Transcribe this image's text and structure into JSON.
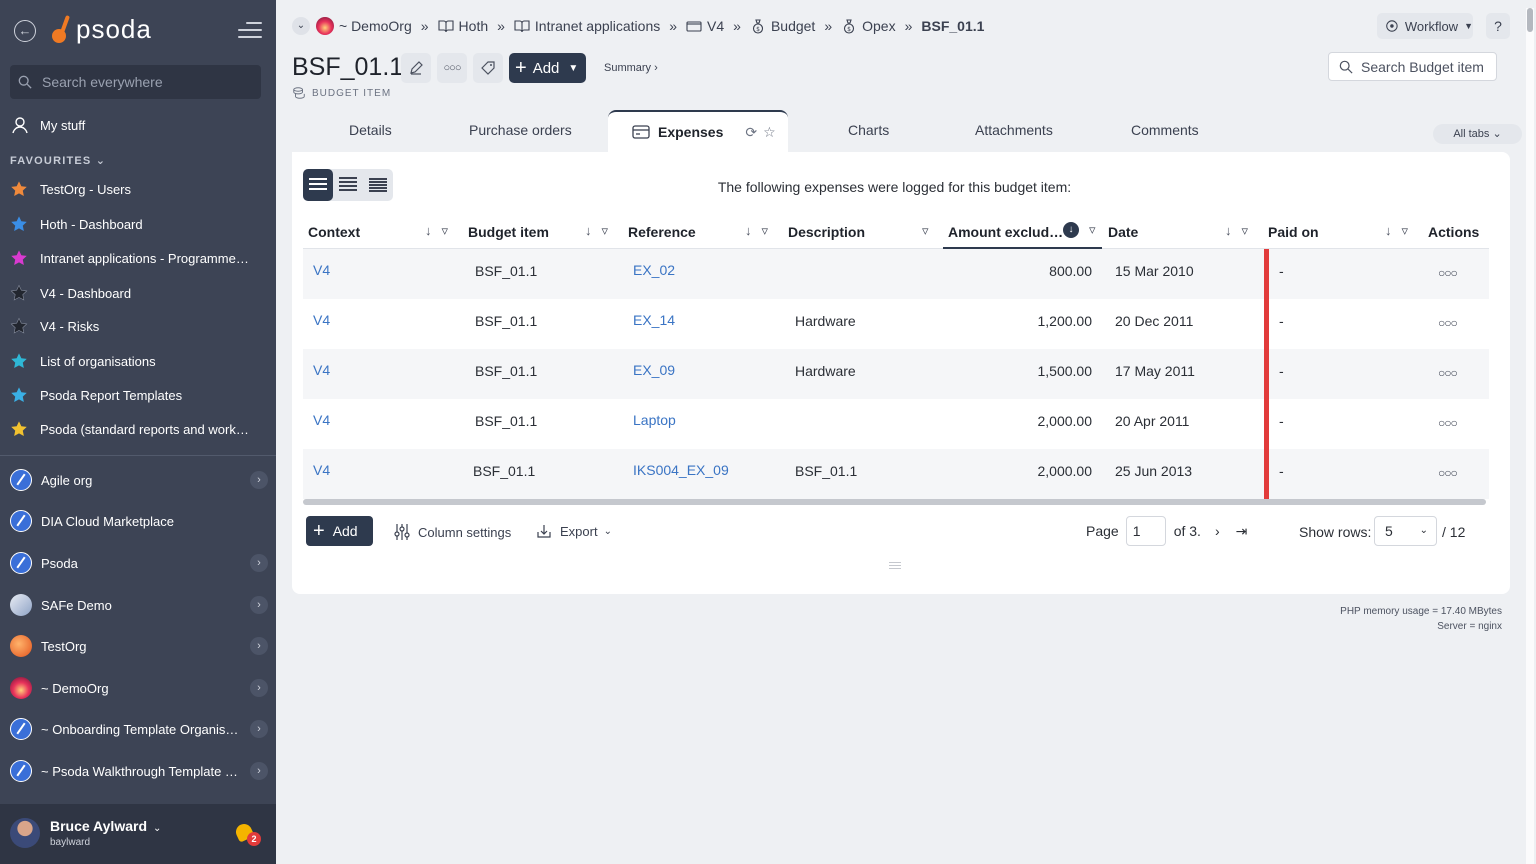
{
  "sidebar": {
    "logo_text": "psoda",
    "search_placeholder": "Search everywhere",
    "my_stuff": "My stuff",
    "favourites_heading": "FAVOURITES",
    "favourites": [
      {
        "label": "TestOrg - Users",
        "star_color": "#f08a3c"
      },
      {
        "label": "Hoth - Dashboard",
        "star_color": "#3a8ee6"
      },
      {
        "label": "Intranet applications - Programme…",
        "star_color": "#d93ad0"
      },
      {
        "label": "V4 - Dashboard",
        "star_color": "#2a2e38"
      },
      {
        "label": "V4 - Risks",
        "star_color": "#2a2e38"
      },
      {
        "label": "List of organisations",
        "star_color": "#2fb8d6"
      },
      {
        "label": "Psoda Report Templates",
        "star_color": "#3ab0e6"
      },
      {
        "label": "Psoda (standard reports and work…",
        "star_color": "#f2c230"
      }
    ],
    "orgs": [
      {
        "label": "Agile org",
        "icon": "compass-icon",
        "chevron": true
      },
      {
        "label": "DIA Cloud Marketplace",
        "icon": "compass-icon",
        "chevron": false
      },
      {
        "label": "Psoda",
        "icon": "compass-icon",
        "chevron": true
      },
      {
        "label": "SAFe Demo",
        "icon": "safe-icon",
        "chevron": true
      },
      {
        "label": "TestOrg",
        "icon": "testorg-icon",
        "chevron": true
      },
      {
        "label": "~ DemoOrg",
        "icon": "demoorg-icon",
        "chevron": true
      },
      {
        "label": "~ Onboarding Template Organisa…",
        "icon": "compass-icon",
        "chevron": true
      },
      {
        "label": "~ Psoda Walkthrough Template P…",
        "icon": "compass-icon",
        "chevron": true
      }
    ],
    "user": {
      "name": "Bruce Aylward",
      "login": "baylward",
      "notifications": "2"
    }
  },
  "breadcrumbs": [
    {
      "label": "~ DemoOrg"
    },
    {
      "label": "Hoth"
    },
    {
      "label": "Intranet applications"
    },
    {
      "label": "V4"
    },
    {
      "label": "Budget"
    },
    {
      "label": "Opex"
    },
    {
      "label": "BSF_01.1"
    }
  ],
  "breadcrumb_sep": "»",
  "header": {
    "workflow": "Workflow",
    "help": "?",
    "title": "BSF_01.1",
    "subtitle": "BUDGET ITEM",
    "add_label": "Add",
    "summary_link": "Summary ›",
    "search_placeholder": "Search Budget item"
  },
  "tabs": {
    "items": [
      "Details",
      "Purchase orders",
      "Expenses",
      "Charts",
      "Attachments",
      "Comments"
    ],
    "active": "Expenses",
    "all_tabs": "All tabs"
  },
  "panel": {
    "message": "The following expenses were logged for this budget item:",
    "columns": [
      "Context",
      "Budget item",
      "Reference",
      "Description",
      "Amount exclud…",
      "Date",
      "Paid on",
      "Actions"
    ],
    "rows": [
      {
        "context": "V4",
        "budget_item": "BSF_01.1",
        "reference": "EX_02",
        "description": "",
        "amount": "800.00",
        "date": "15 Mar 2010",
        "paid_on": "-"
      },
      {
        "context": "V4",
        "budget_item": "BSF_01.1",
        "reference": "EX_14",
        "description": "Hardware",
        "amount": "1,200.00",
        "date": "20 Dec 2011",
        "paid_on": "-"
      },
      {
        "context": "V4",
        "budget_item": "BSF_01.1",
        "reference": "EX_09",
        "description": "Hardware",
        "amount": "1,500.00",
        "date": "17 May 2011",
        "paid_on": "-"
      },
      {
        "context": "V4",
        "budget_item": "BSF_01.1",
        "reference": "Laptop",
        "description": "",
        "amount": "2,000.00",
        "date": "20 Apr 2011",
        "paid_on": "-"
      },
      {
        "context": "V4",
        "budget_item": "BSF_01.1",
        "reference": "IKS004_EX_09",
        "description": "BSF_01.1",
        "amount": "2,000.00",
        "date": "25 Jun 2013",
        "paid_on": "-"
      }
    ],
    "footer": {
      "add_label": "Add",
      "column_settings": "Column settings",
      "export": "Export",
      "page_label": "Page",
      "page_value": "1",
      "page_of": "of 3.",
      "show_rows_label": "Show rows:",
      "rows_value": "5",
      "rows_total": "/ 12"
    }
  },
  "server_info": {
    "memory": "PHP memory usage = 17.40 MBytes",
    "server": "Server = nginx"
  },
  "colors": {
    "sidebar_bg": "#3d4455",
    "accent_dark": "#2e3a4e",
    "link": "#3a74c4",
    "status_red": "#e23b3b"
  }
}
